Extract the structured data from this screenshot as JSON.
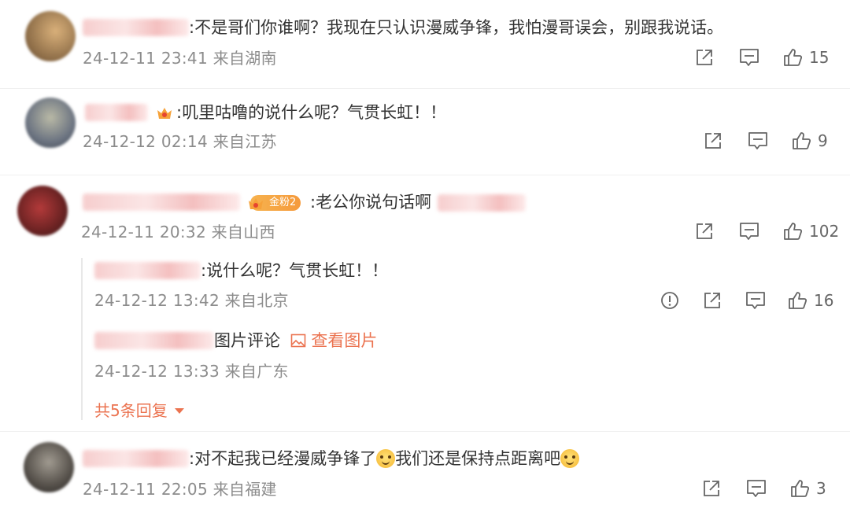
{
  "comments": [
    {
      "text": ":不是哥们你谁啊？我现在只认识漫威争锋，我怕漫哥误会，别跟我说话。",
      "meta": "24-12-11 23:41 来自湖南",
      "likes": "15"
    },
    {
      "text": ":叽里咕噜的说什么呢？气贯长虹！！",
      "meta": "24-12-12 02:14 来自江苏",
      "likes": "9"
    },
    {
      "text": ":老公你说句话啊",
      "fan_badge": "金粉2",
      "meta": "24-12-11 20:32 来自山西",
      "likes": "102"
    },
    {
      "text": ":对不起我已经漫威争锋了",
      "text2": "我们还是保持点距离吧",
      "meta": "24-12-11 22:05 来自福建",
      "likes": "3"
    }
  ],
  "replies": [
    {
      "text": ":说什么呢？气贯长虹！！",
      "meta": "24-12-12 13:42 来自北京",
      "likes": "16"
    },
    {
      "text": "图片评论",
      "view_pic": "查看图片",
      "meta": "24-12-12 13:33 来自广东"
    }
  ],
  "more_replies": "共5条回复",
  "colors": {
    "accent": "#eb7350",
    "meta": "#8c8c8c",
    "icon": "#666666"
  },
  "icons": [
    "share-icon",
    "comment-icon",
    "like-icon",
    "report-icon"
  ]
}
